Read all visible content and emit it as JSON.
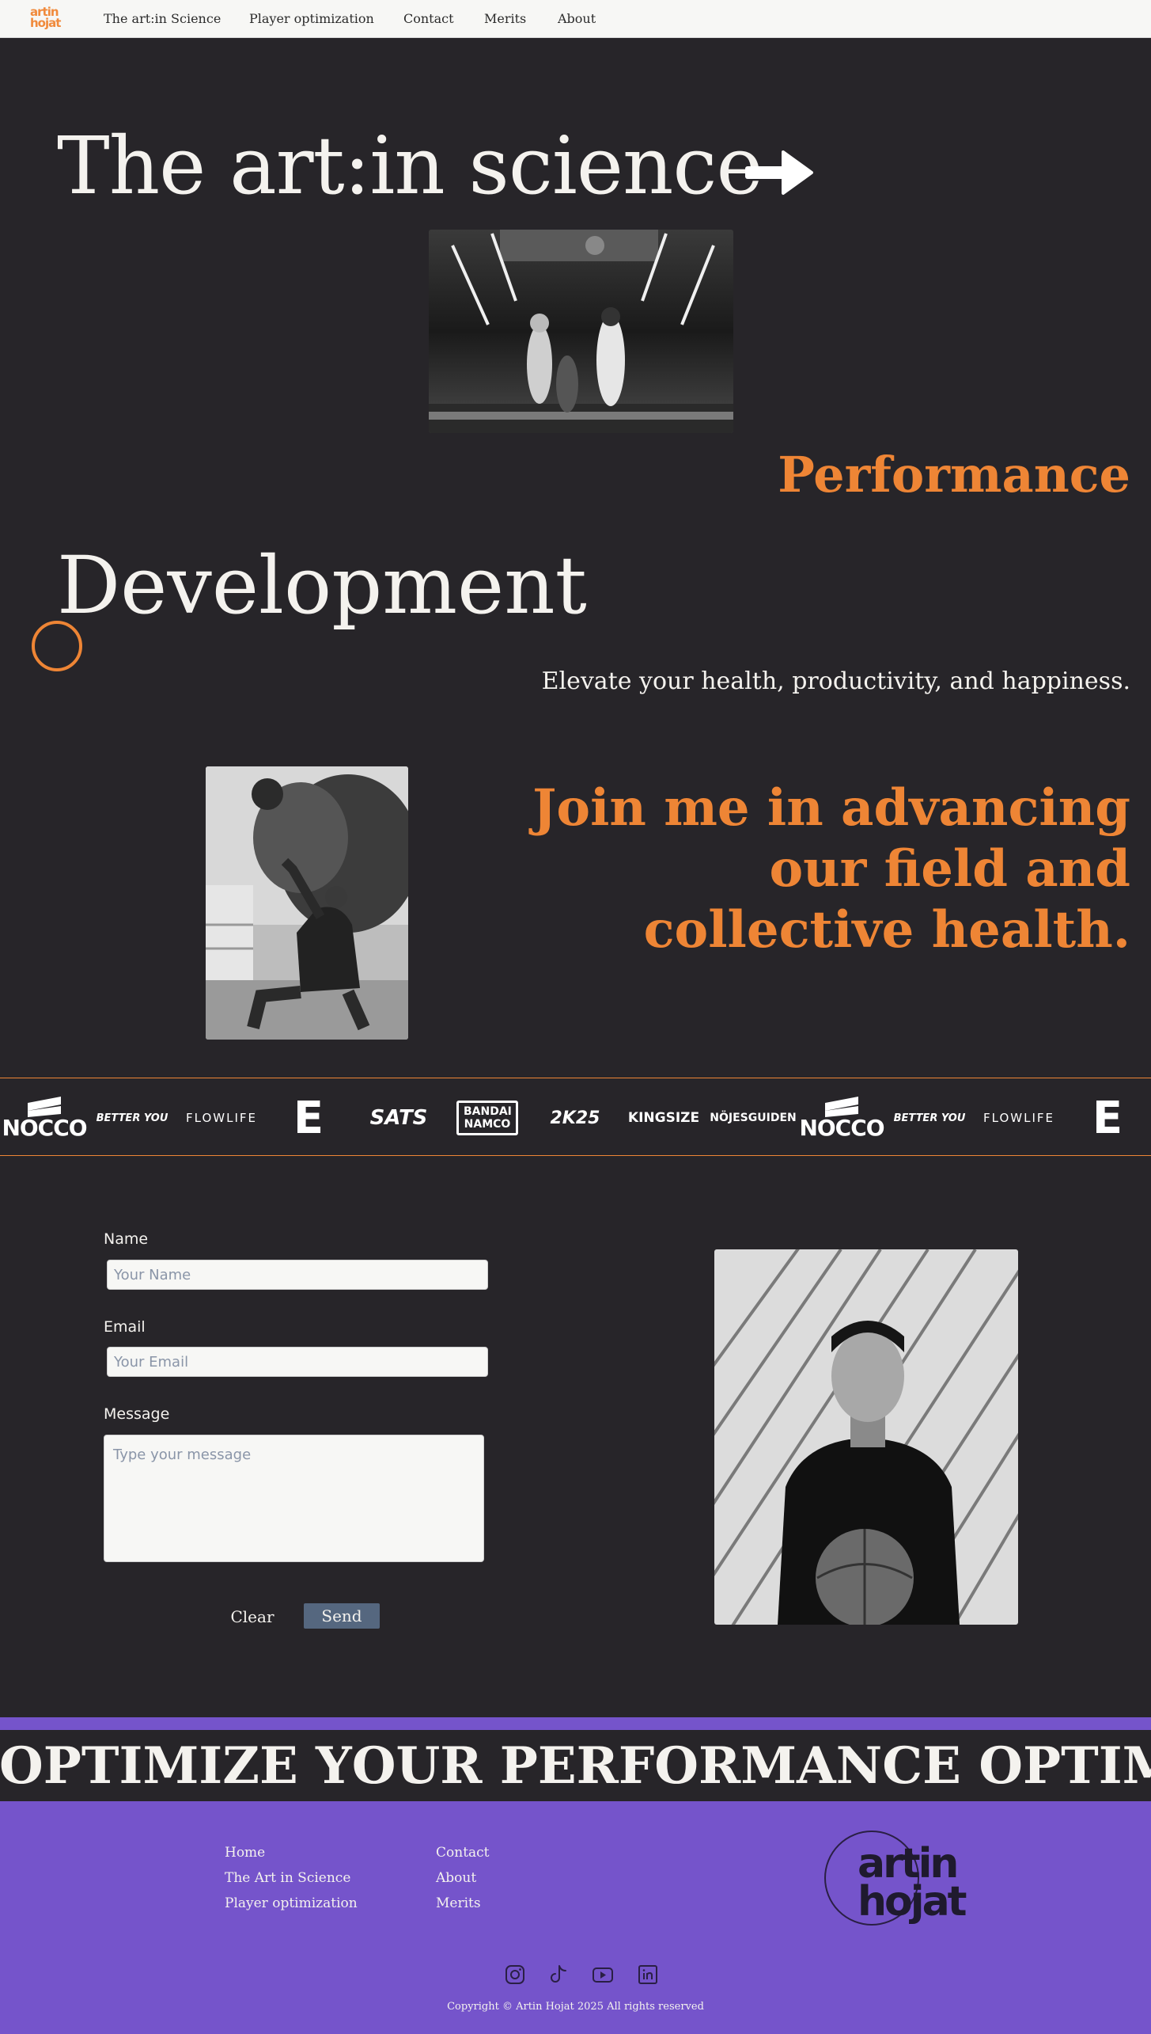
{
  "nav": {
    "logo_line1": "artin",
    "logo_line2": "hojat",
    "links": [
      "The art:in Science",
      "Player optimization",
      "Contact",
      "Merits",
      "About"
    ]
  },
  "hero": {
    "title": "The art:in science",
    "arrow_icon": "arrow-right-icon",
    "performance": "Performance",
    "development": "Development",
    "tagline": "Elevate your health, productivity, and happiness.",
    "join": "Join me in advancing our field and collective health."
  },
  "sponsors": [
    "NOCCO",
    "BETTER YOU",
    "FLOWLIFE",
    "E",
    "SATS",
    "BANDAI NAMCO",
    "2K25",
    "KINGSIZE",
    "NÖJESGUIDEN",
    "NOCCO",
    "BETTER YOU",
    "FLOWLIFE",
    "E"
  ],
  "form": {
    "name_label": "Name",
    "name_placeholder": "Your Name",
    "email_label": "Email",
    "email_placeholder": "Your Email",
    "message_label": "Message",
    "message_placeholder": "Type your message",
    "clear_label": "Clear",
    "send_label": "Send"
  },
  "banner": {
    "text": "OPTIMIZE YOUR PERFORMANCE OPTIMIZE YOUR PERFORMANCE"
  },
  "footer": {
    "col1": [
      "Home",
      "The Art in Science",
      "Player optimization"
    ],
    "col2": [
      "Contact",
      "About",
      "Merits"
    ],
    "logo_line1": "artin",
    "logo_line2": "hojat",
    "social_icons": [
      "instagram-icon",
      "tiktok-icon",
      "youtube-icon",
      "linkedin-icon"
    ],
    "copyright": "Copyright © Artin Hojat 2025 All rights reserved"
  },
  "colors": {
    "background": "#272529",
    "accent_orange": "#ee8535",
    "footer_purple": "#7554cb",
    "nav_bg": "#f7f7f5",
    "send_button": "#55677f"
  }
}
